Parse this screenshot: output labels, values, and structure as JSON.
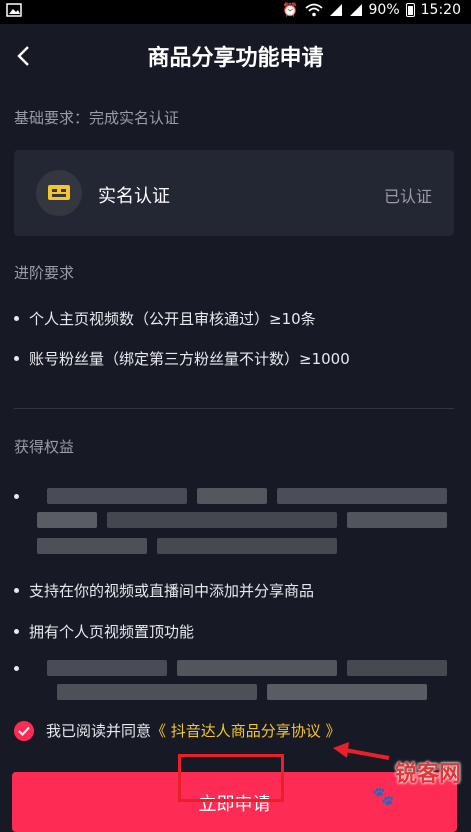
{
  "status_bar": {
    "battery": "90%",
    "time": "15:20",
    "icons": [
      "image-icon",
      "alarm-icon",
      "wifi-icon",
      "signal-icon",
      "signal-icon",
      "battery-icon"
    ]
  },
  "nav": {
    "title": "商品分享功能申请",
    "back_icon": "back-chevron-icon"
  },
  "basic": {
    "label": "基础要求：完成实名认证"
  },
  "verification_card": {
    "title": "实名认证",
    "status": "已认证",
    "icon": "id-card-icon",
    "accent": "#f5c52e"
  },
  "advanced": {
    "label": "进阶要求",
    "items": [
      "个人主页视频数（公开且审核通过）≥10条",
      "账号粉丝量（绑定第三方粉丝量不计数）≥1000"
    ]
  },
  "benefits": {
    "label": "获得权益",
    "items": [
      "支持在你的视频或直播间中添加并分享商品",
      "拥有个人页视频置顶功能"
    ]
  },
  "agreement": {
    "prefix": "我已阅读并同意",
    "link": "《 抖音达人商品分享协议 》",
    "checked": true
  },
  "submit": {
    "label": "立即申请",
    "color": "#fe2c55"
  },
  "watermark": {
    "text": "锐客网"
  }
}
